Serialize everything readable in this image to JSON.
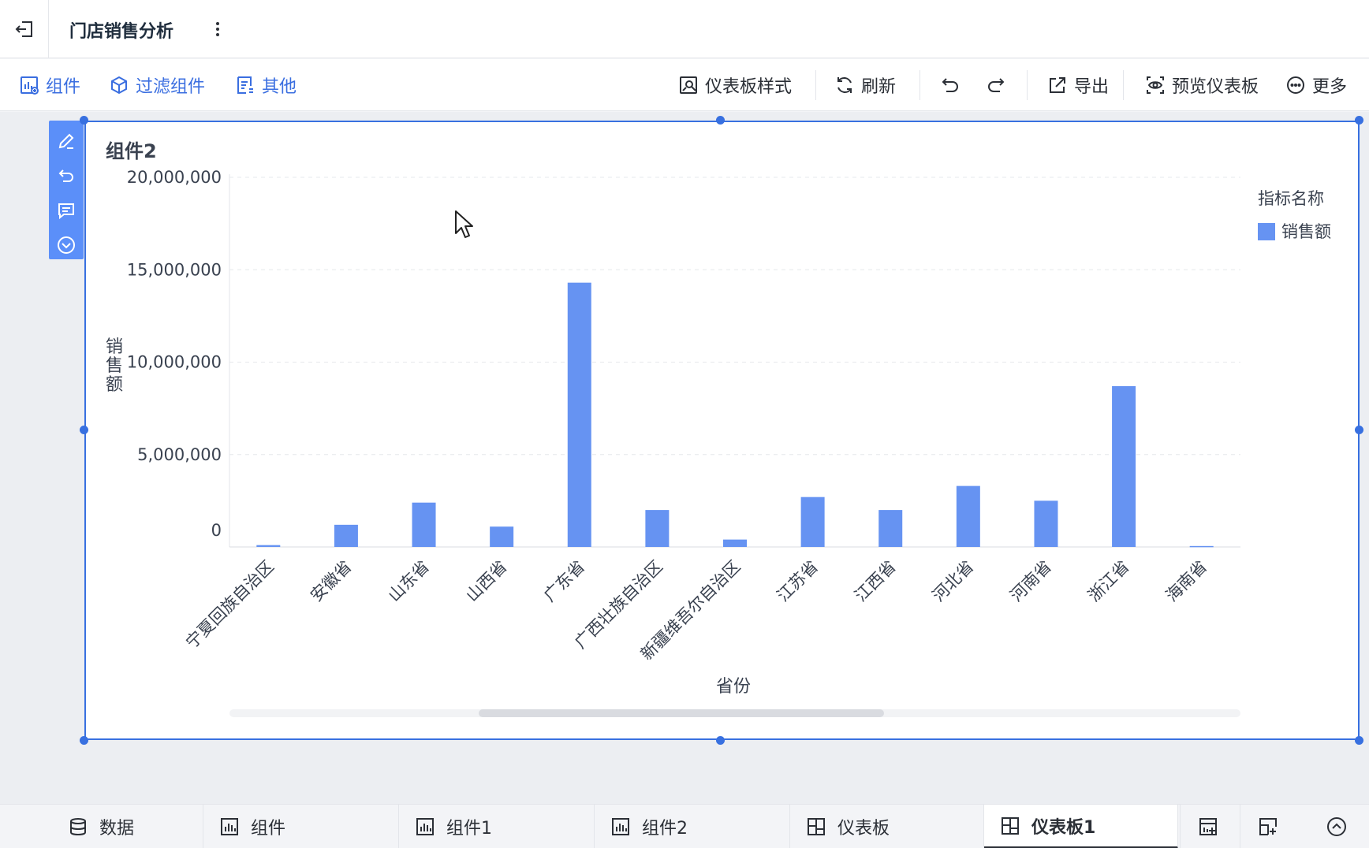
{
  "app": {
    "title": "门店销售分析"
  },
  "toolbar": {
    "component": "组件",
    "filter_component": "过滤组件",
    "other": "其他",
    "dashboard_style": "仪表板样式",
    "refresh": "刷新",
    "export": "导出",
    "preview_dashboard": "预览仪表板",
    "more": "更多"
  },
  "widget": {
    "title": "组件2"
  },
  "chart_data": {
    "type": "bar",
    "xlabel": "省份",
    "ylabel": "销售额",
    "ylim": [
      0,
      20000000
    ],
    "yticks": [
      {
        "value": 0,
        "label": "0"
      },
      {
        "value": 5000000,
        "label": "5,000,000"
      },
      {
        "value": 10000000,
        "label": "10,000,000"
      },
      {
        "value": 15000000,
        "label": "15,000,000"
      },
      {
        "value": 20000000,
        "label": "20,000,000"
      }
    ],
    "grid": true,
    "legend": {
      "title": "指标名称",
      "position": "top-right"
    },
    "categories": [
      "宁夏回族自治区",
      "安徽省",
      "山东省",
      "山西省",
      "广东省",
      "广西壮族自治区",
      "新疆维吾尔自治区",
      "江苏省",
      "江西省",
      "河北省",
      "河南省",
      "浙江省",
      "海南省"
    ],
    "series": [
      {
        "name": "销售额",
        "color": "#6693f2",
        "values": [
          100000,
          1200000,
          2400000,
          1100000,
          14300000,
          2000000,
          400000,
          2700000,
          2000000,
          3300000,
          2500000,
          8700000,
          50000
        ]
      }
    ]
  },
  "bottom_tabs": {
    "data": "数据",
    "component": "组件",
    "component1": "组件1",
    "component2": "组件2",
    "dashboard": "仪表板",
    "dashboard1": "仪表板1"
  },
  "colors": {
    "accent": "#3870e0",
    "bar": "#6693f2"
  }
}
